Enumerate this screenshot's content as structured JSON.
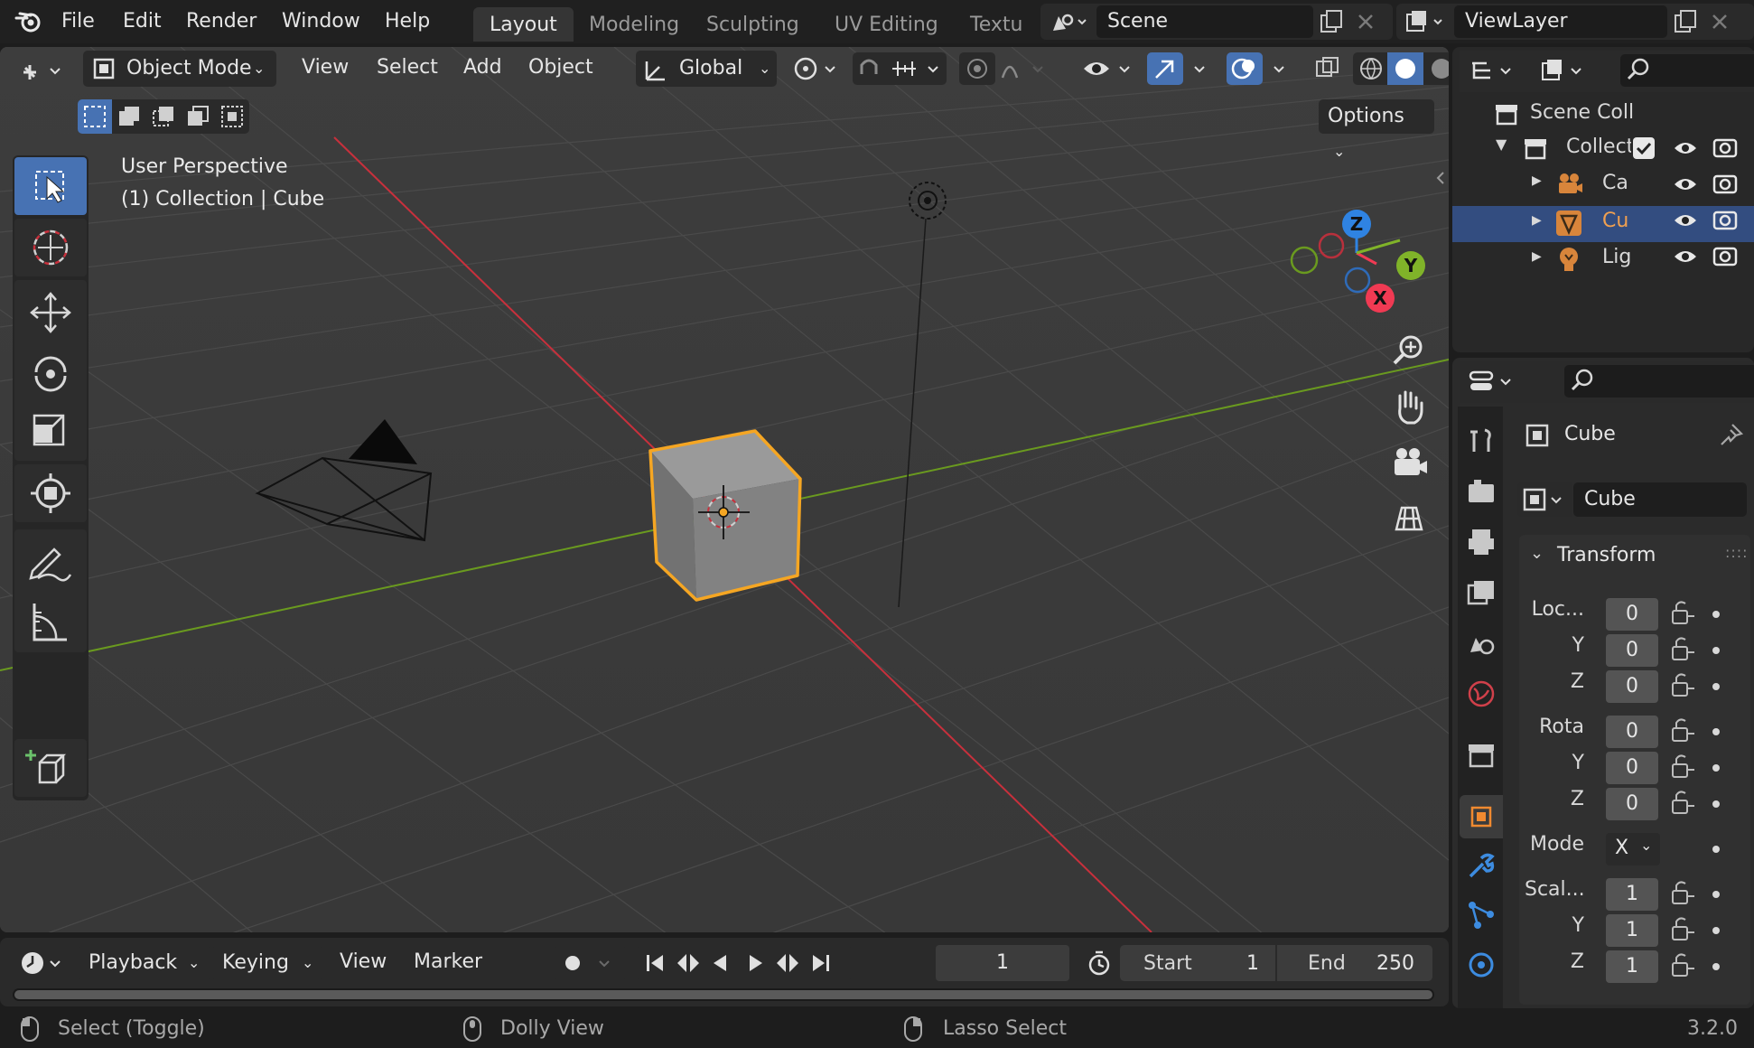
{
  "menu": {
    "file": "File",
    "edit": "Edit",
    "render": "Render",
    "window": "Window",
    "help": "Help"
  },
  "workspaces": [
    {
      "label": "Layout",
      "active": true
    },
    {
      "label": "Modeling",
      "active": false
    },
    {
      "label": "Sculpting",
      "active": false
    },
    {
      "label": "UV Editing",
      "active": false
    },
    {
      "label": "Textu",
      "active": false
    }
  ],
  "scene": {
    "name": "Scene"
  },
  "view_layer": {
    "name": "ViewLayer"
  },
  "viewport_header": {
    "mode": "Object Mode",
    "menus": [
      "View",
      "Select",
      "Add",
      "Object"
    ],
    "transform_orientation": "Global",
    "options": "Options"
  },
  "viewport": {
    "perspective": "User Perspective",
    "context": "(1) Collection | Cube",
    "gizmo": {
      "x": "X",
      "y": "Y",
      "z": "Z"
    }
  },
  "outliner": {
    "scene_collection": "Scene Coll",
    "collection": "Collect",
    "items": [
      {
        "label": "Ca",
        "icon": "camera-icon",
        "selected": false
      },
      {
        "label": "Cu",
        "icon": "mesh-icon",
        "selected": true
      },
      {
        "label": "Lig",
        "icon": "light-icon",
        "selected": false
      }
    ]
  },
  "properties": {
    "object_name": "Cube",
    "data_name": "Cube",
    "transform_label": "Transform",
    "location": {
      "label": "Loc...",
      "x": "0",
      "y": "0",
      "z": "0"
    },
    "rotation": {
      "label": "Rota",
      "x": "0",
      "y": "0",
      "z": "0"
    },
    "mode": {
      "label": "Mode",
      "value": "X"
    },
    "scale": {
      "label": "Scal...",
      "x": "1",
      "y": "1",
      "z": "1"
    },
    "axis_y": "Y",
    "axis_z": "Z"
  },
  "timeline": {
    "playback": "Playback",
    "keying": "Keying",
    "view": "View",
    "marker": "Marker",
    "current_frame": "1",
    "start_label": "Start",
    "start_value": "1",
    "end_label": "End",
    "end_value": "250"
  },
  "statusbar": {
    "select": "Select (Toggle)",
    "dolly": "Dolly View",
    "lasso": "Lasso Select",
    "version": "3.2.0"
  },
  "colors": {
    "accent_blue": "#4772b3",
    "selection_orange": "#f5a623",
    "axis_red": "#c8303c",
    "axis_green": "#6a9a1f",
    "gizmo_x": "#f03a53",
    "gizmo_y": "#80b329",
    "gizmo_z": "#2f83e2"
  }
}
